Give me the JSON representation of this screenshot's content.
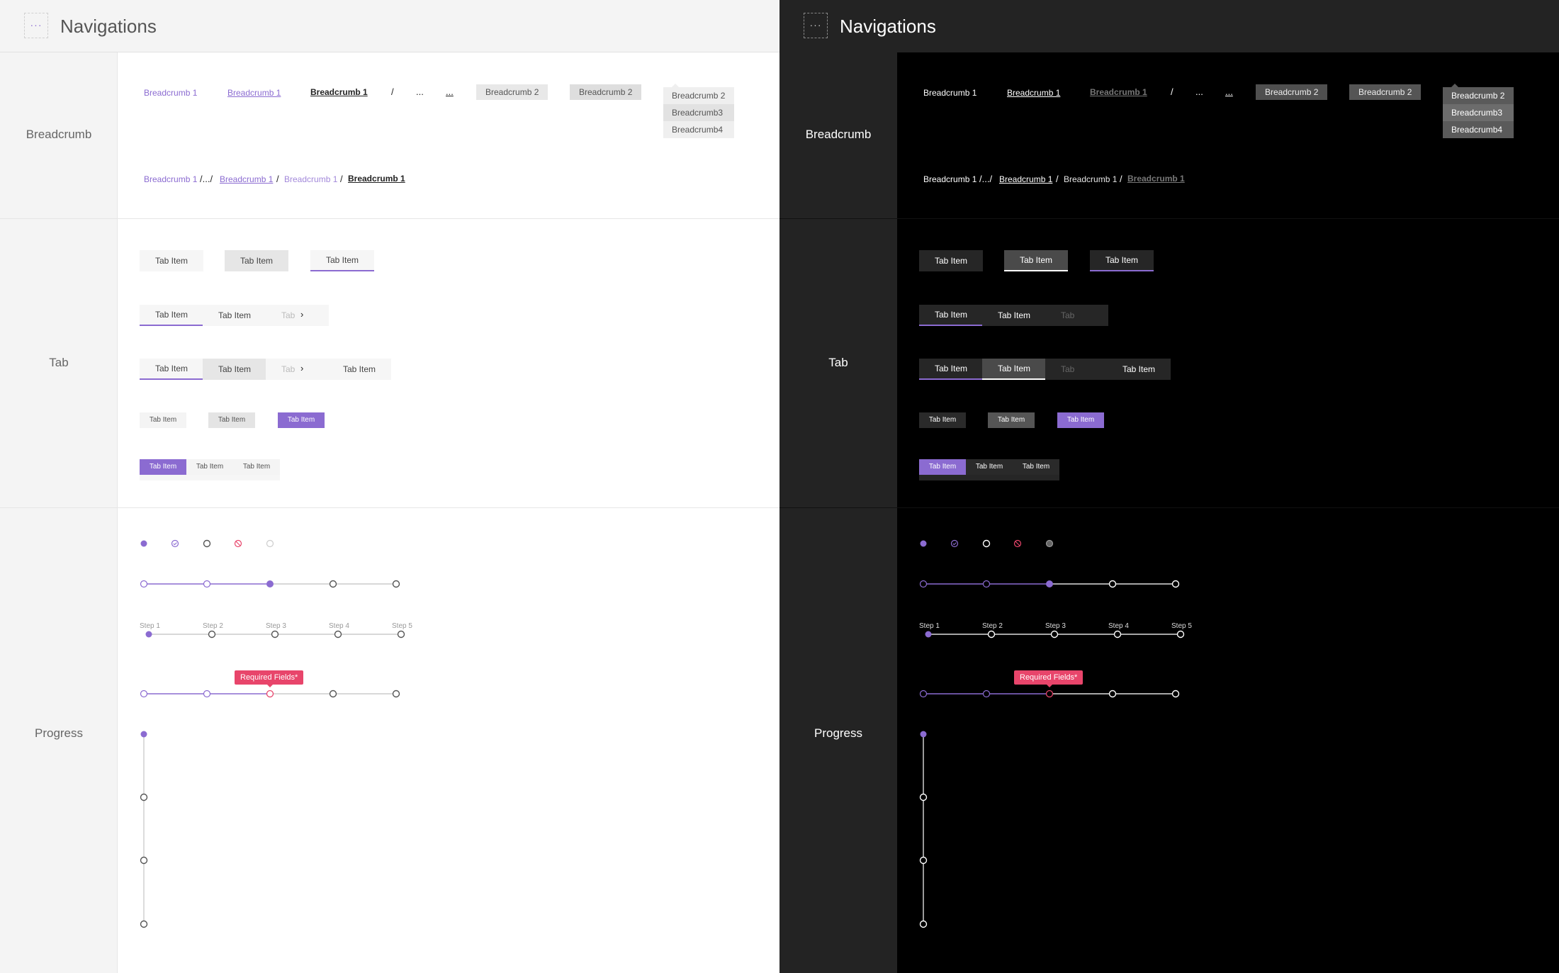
{
  "title": "Navigations",
  "header_icon": "dots-frame-icon",
  "sections": {
    "breadcrumb": "Breadcrumb",
    "tab": "Tab",
    "progress": "Progress"
  },
  "breadcrumb": {
    "item1": "Breadcrumb 1",
    "item2": "Breadcrumb 2",
    "separator": "/",
    "ellipsis": "...",
    "path_ellipsis": "/.../",
    "dropdown": [
      "Breadcrumb 2",
      "Breadcrumb3",
      "Breadcrumb4"
    ],
    "trail": {
      "first": "Breadcrumb 1",
      "second": "Breadcrumb 1",
      "third": "Breadcrumb 1",
      "current": "Breadcrumb 1"
    }
  },
  "tabs": {
    "label": "Tab Item",
    "truncated": "Tab",
    "chevron": "›"
  },
  "progress": {
    "steps": [
      "Step 1",
      "Step 2",
      "Step 3",
      "Step 4",
      "Step 5"
    ],
    "tooltip": "Required Fields*",
    "progress_value": 0.5
  },
  "colors": {
    "accent": "#8b6bd1",
    "error": "#e8456b"
  }
}
